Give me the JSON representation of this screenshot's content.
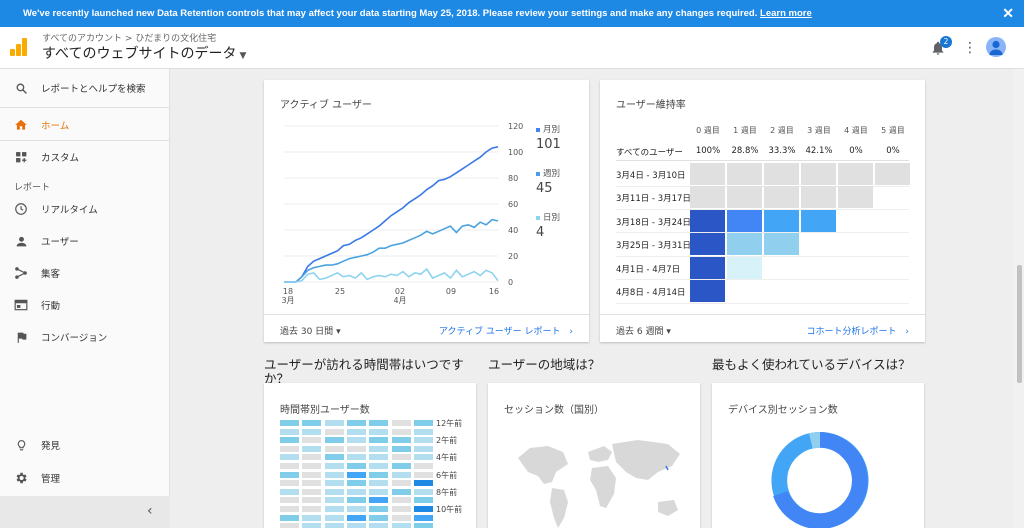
{
  "banner": {
    "message": "We've recently launched new Data Retention controls that may affect your data starting May 25, 2018. Please review your settings and make any changes required.",
    "link": "Learn more",
    "close": "✕"
  },
  "header": {
    "crumb_all": "すべてのアカウント",
    "crumb_sep": ">",
    "crumb_site": "ひだまりの文化住宅",
    "property": "すべてのウェブサイトのデータ",
    "notification_count": "2"
  },
  "sidebar": {
    "search": "レポートとヘルプを検索",
    "home": "ホーム",
    "custom": "カスタム",
    "reports_section": "レポート",
    "realtime": "リアルタイム",
    "users": "ユーザー",
    "acquisition": "集客",
    "behavior": "行動",
    "conversions": "コンバージョン",
    "discover": "発見",
    "admin": "管理"
  },
  "active_users": {
    "title": "アクティブ ユーザー",
    "footer_range": "過去 30 日間",
    "footer_link": "アクティブ ユーザー レポート",
    "legend": [
      {
        "label": "月別",
        "value": "101",
        "color": "#4285f4"
      },
      {
        "label": "週別",
        "value": "45",
        "color": "#4c9be8"
      },
      {
        "label": "日別",
        "value": "4",
        "color": "#8dd3f0"
      }
    ]
  },
  "chart_data": {
    "type": "line",
    "title": "アクティブ ユーザー",
    "x_ticks": [
      {
        "label": "18",
        "sub": "3月"
      },
      {
        "label": "25",
        "sub": ""
      },
      {
        "label": "02",
        "sub": "4月"
      },
      {
        "label": "09",
        "sub": ""
      },
      {
        "label": "16",
        "sub": ""
      }
    ],
    "ylim": [
      0,
      120
    ],
    "y_ticks": [
      0,
      20,
      40,
      60,
      80,
      100,
      120
    ],
    "grid": true,
    "series": [
      {
        "name": "月別",
        "color": "#3b78e7",
        "values": [
          0,
          0,
          0,
          4,
          12,
          16,
          18,
          20,
          22,
          24,
          28,
          29,
          32,
          34,
          37,
          40,
          43,
          47,
          51,
          54,
          57,
          61,
          64,
          67,
          71,
          74,
          78,
          79,
          81,
          84,
          87,
          90,
          93,
          96,
          100,
          103,
          104
        ]
      },
      {
        "name": "週別",
        "color": "#4aa3df",
        "values": [
          0,
          0,
          0,
          4,
          9,
          11,
          12,
          13,
          13,
          14,
          16,
          18,
          19,
          20,
          21,
          23,
          26,
          26,
          28,
          29,
          30,
          32,
          34,
          36,
          39,
          37,
          39,
          41,
          43,
          38,
          43,
          44,
          42,
          46,
          44,
          48,
          47
        ]
      },
      {
        "name": "日別",
        "color": "#8fd3ef",
        "values": [
          0,
          0,
          0,
          1,
          6,
          7,
          2,
          3,
          5,
          7,
          4,
          5,
          3,
          7,
          2,
          4,
          5,
          4,
          6,
          5,
          8,
          4,
          7,
          6,
          10,
          3,
          5,
          7,
          3,
          9,
          4,
          6,
          8,
          5,
          9,
          7,
          1
        ]
      }
    ]
  },
  "retention": {
    "title": "ユーザー維持率",
    "weeks": [
      "0 週目",
      "1 週目",
      "2 週目",
      "3 週目",
      "4 週目",
      "5 週目"
    ],
    "all_users_label": "すべてのユーザー",
    "all_users_values": [
      "100%",
      "28.8%",
      "33.3%",
      "42.1%",
      "0%",
      "0%"
    ],
    "rows": [
      {
        "label": "3月4日 - 3月10日",
        "cells": [
          "#e0e0e0",
          "#e0e0e0",
          "#e0e0e0",
          "#e0e0e0",
          "#e0e0e0",
          "#e0e0e0"
        ]
      },
      {
        "label": "3月11日 - 3月17日",
        "cells": [
          "#e0e0e0",
          "#e0e0e0",
          "#e0e0e0",
          "#e0e0e0",
          "#e0e0e0"
        ]
      },
      {
        "label": "3月18日 - 3月24日",
        "cells": [
          "#2a56c6",
          "#4285f4",
          "#42a5f5",
          "#42a5f5"
        ]
      },
      {
        "label": "3月25日 - 3月31日",
        "cells": [
          "#2a56c6",
          "#90d0ee",
          "#90d0ee"
        ]
      },
      {
        "label": "4月1日 - 4月7日",
        "cells": [
          "#2a56c6",
          "#d7f3f9"
        ]
      },
      {
        "label": "4月8日 - 4月14日",
        "cells": [
          "#2a56c6"
        ]
      }
    ],
    "footer_range": "過去 6 週間",
    "footer_link": "コホート分析レポート"
  },
  "questions": {
    "time": "ユーザーが訪れる時間帯はいつですか？",
    "region": "ユーザーの地域は？",
    "device": "最もよく使われているデバイスは？"
  },
  "time_card": {
    "title": "時間帯別ユーザー数",
    "hour_labels": [
      "12午前",
      "2午前",
      "4午前",
      "6午前",
      "8午前",
      "10午前"
    ]
  },
  "geo_card": {
    "title": "セッション数（国別）"
  },
  "device_card": {
    "title": "デバイス別セッション数"
  }
}
